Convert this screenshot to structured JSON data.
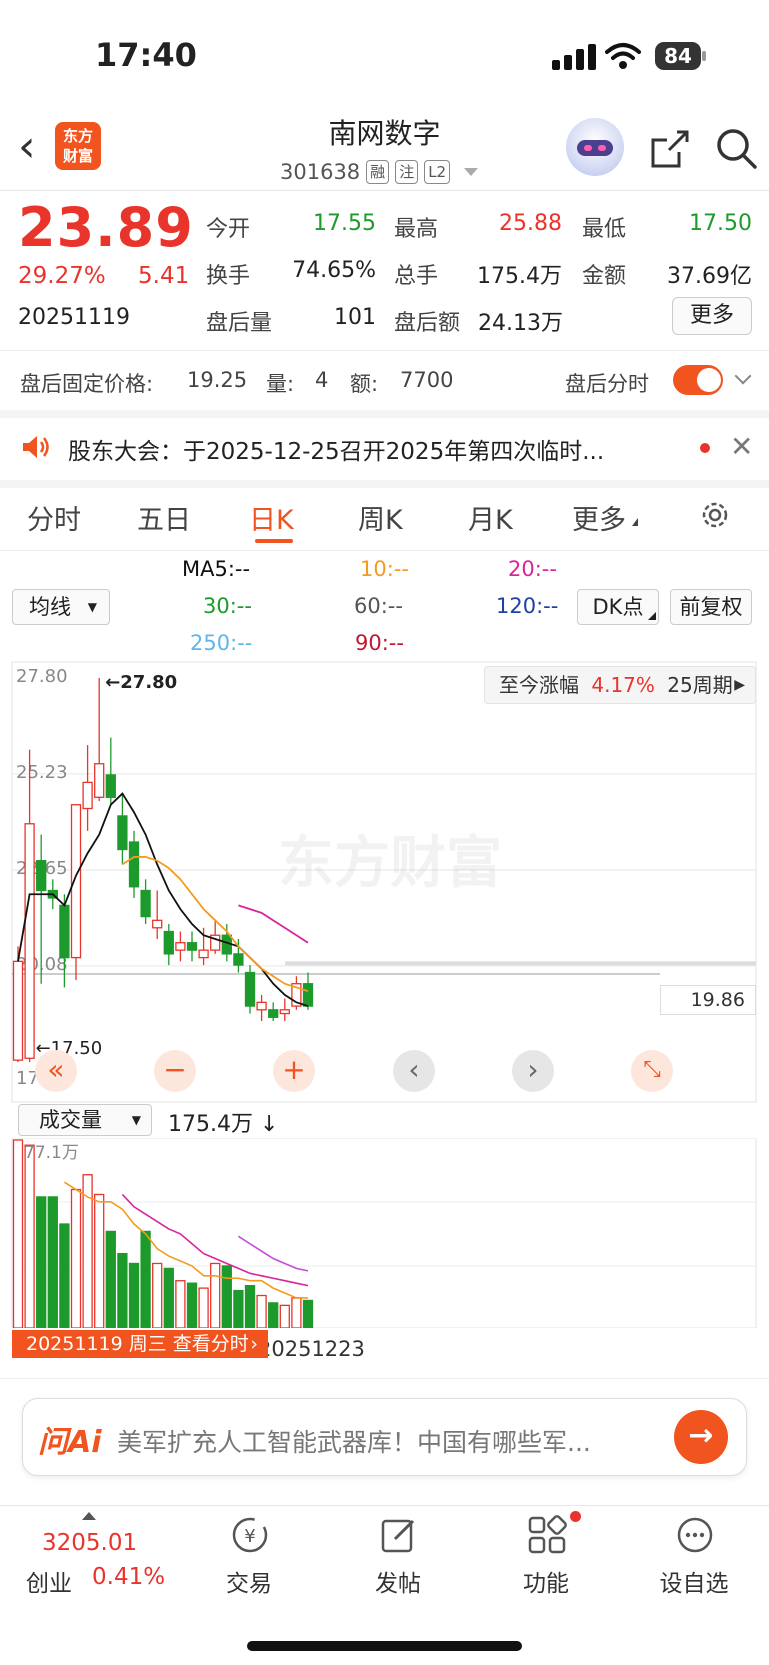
{
  "status_bar": {
    "time": "17:40",
    "battery": "84"
  },
  "header": {
    "logo_line1": "东方",
    "logo_line2": "财富",
    "stock_name": "南网数字",
    "stock_code": "301638",
    "tags": [
      "融",
      "注",
      "L2"
    ]
  },
  "quote": {
    "price": "23.89",
    "change_pct": "29.27%",
    "change_amt": "5.41",
    "date": "20251119",
    "rows": [
      [
        {
          "label": "今开",
          "value": "17.55",
          "color": "green"
        },
        {
          "label": "最高",
          "value": "25.88",
          "color": "red"
        },
        {
          "label": "最低",
          "value": "17.50",
          "color": "green"
        }
      ],
      [
        {
          "label": "换手",
          "value": "74.65%",
          "color": "plain"
        },
        {
          "label": "总手",
          "value": "175.4万",
          "color": "plain"
        },
        {
          "label": "金额",
          "value": "37.69亿",
          "color": "plain"
        }
      ],
      [
        {
          "label": "盘后量",
          "value": "101",
          "color": "plain"
        },
        {
          "label": "盘后额",
          "value": "24.13万",
          "color": "plain"
        }
      ]
    ],
    "more_label": "更多"
  },
  "after_hours": {
    "price_label": "盘后固定价格:",
    "price": "19.25",
    "vol_label": "量:",
    "vol": "4",
    "amt_label": "额:",
    "amt": "7700",
    "timeshare_label": "盘后分时"
  },
  "notice": {
    "text": "股东大会：于2025-12-25召开2025年第四次临时..."
  },
  "tabs": {
    "items": [
      "分时",
      "五日",
      "日K",
      "周K",
      "月K",
      "更多"
    ],
    "active": "日K"
  },
  "ma": {
    "selector": "均线",
    "ma5": "MA5:--",
    "ma10": "10:--",
    "ma20": "20:--",
    "ma30": "30:--",
    "ma60": "60:--",
    "ma120": "120:--",
    "ma250": "250:--",
    "ma90": "90:--",
    "dk_label": "DK点",
    "adjust_label": "前复权"
  },
  "colors": {
    "accent": "#f1541e",
    "up": "#e8342b",
    "down": "#1d9a2c",
    "ma5": "#111111",
    "ma10": "#f39b1f",
    "ma20": "#d9259b"
  },
  "chart_data": {
    "type": "candlestick",
    "y_ticks": [
      "27.80",
      "25.23",
      "22.65",
      "20.08",
      "17.50"
    ],
    "ylim": [
      17.5,
      27.8
    ],
    "high_marker": "27.80",
    "low_marker": "17.50",
    "last_price": "19.86",
    "range_label": "至今涨幅",
    "range_pct": "4.17%",
    "range_period": "25周期",
    "watermark": "东方财富",
    "candles": [
      {
        "o": 17.55,
        "c": 20.2,
        "h": 20.6,
        "l": 17.5
      },
      {
        "o": 17.6,
        "c": 23.89,
        "h": 25.88,
        "l": 17.5
      },
      {
        "o": 22.9,
        "c": 22.1,
        "h": 23.6,
        "l": 19.6
      },
      {
        "o": 22.1,
        "c": 21.9,
        "h": 22.4,
        "l": 21.6
      },
      {
        "o": 21.7,
        "c": 20.3,
        "h": 22.0,
        "l": 19.5
      },
      {
        "o": 20.3,
        "c": 24.4,
        "h": 24.4,
        "l": 19.7
      },
      {
        "o": 24.3,
        "c": 25.0,
        "h": 26.0,
        "l": 23.7
      },
      {
        "o": 24.6,
        "c": 25.5,
        "h": 27.8,
        "l": 24.5
      },
      {
        "o": 25.2,
        "c": 24.6,
        "h": 26.2,
        "l": 24.4
      },
      {
        "o": 24.1,
        "c": 23.2,
        "h": 24.7,
        "l": 22.8
      },
      {
        "o": 23.4,
        "c": 22.2,
        "h": 23.7,
        "l": 21.9
      },
      {
        "o": 22.1,
        "c": 21.4,
        "h": 22.4,
        "l": 21.2
      },
      {
        "o": 21.1,
        "c": 21.3,
        "h": 22.1,
        "l": 20.8
      },
      {
        "o": 21.0,
        "c": 20.4,
        "h": 21.2,
        "l": 20.1
      },
      {
        "o": 20.5,
        "c": 20.7,
        "h": 21.0,
        "l": 20.2
      },
      {
        "o": 20.7,
        "c": 20.5,
        "h": 21.0,
        "l": 20.2
      },
      {
        "o": 20.3,
        "c": 20.5,
        "h": 21.1,
        "l": 20.1
      },
      {
        "o": 20.5,
        "c": 20.9,
        "h": 21.3,
        "l": 20.4
      },
      {
        "o": 20.9,
        "c": 20.4,
        "h": 21.2,
        "l": 20.2
      },
      {
        "o": 20.4,
        "c": 20.1,
        "h": 20.8,
        "l": 19.9
      },
      {
        "o": 19.9,
        "c": 19.0,
        "h": 20.1,
        "l": 18.8
      },
      {
        "o": 18.9,
        "c": 19.1,
        "h": 19.3,
        "l": 18.6
      },
      {
        "o": 18.9,
        "c": 18.7,
        "h": 19.1,
        "l": 18.6
      },
      {
        "o": 18.8,
        "c": 18.9,
        "h": 19.2,
        "l": 18.6
      },
      {
        "o": 19.0,
        "c": 19.6,
        "h": 19.8,
        "l": 18.9
      },
      {
        "o": 19.6,
        "c": 19.0,
        "h": 19.9,
        "l": 18.9
      }
    ],
    "ma5": [
      20.2,
      22.0,
      22.0,
      22.0,
      21.7,
      22.5,
      23.1,
      23.6,
      24.4,
      24.7,
      24.2,
      23.6,
      22.8,
      22.1,
      21.6,
      21.2,
      20.9,
      20.8,
      20.7,
      20.6,
      20.3,
      20.0,
      19.6,
      19.3,
      19.1,
      19.0
    ],
    "ma10": [
      null,
      null,
      null,
      null,
      null,
      null,
      null,
      null,
      null,
      22.8,
      23.0,
      23.0,
      22.9,
      22.7,
      22.4,
      22.0,
      21.6,
      21.3,
      21.0,
      20.6,
      20.3,
      20.0,
      19.8,
      19.6,
      19.5,
      19.4
    ],
    "ma20": [
      null,
      null,
      null,
      null,
      null,
      null,
      null,
      null,
      null,
      null,
      null,
      null,
      null,
      null,
      null,
      null,
      null,
      null,
      null,
      21.7,
      21.6,
      21.5,
      21.3,
      21.1,
      20.9,
      20.7
    ],
    "volume": {
      "selector": "成交量",
      "current": "175.4万",
      "max_label": "77.1万",
      "ymax": 77.1,
      "values": [
        77.1,
        75.0,
        54.0,
        54.0,
        43.0,
        57.0,
        63.0,
        55.0,
        40.0,
        31.0,
        27.0,
        40.0,
        27.0,
        25.0,
        20.0,
        19.0,
        17.0,
        27.0,
        26.0,
        16.0,
        18.0,
        14.0,
        11.0,
        10.0,
        13.0,
        12.0
      ],
      "ma5": [
        null,
        null,
        null,
        null,
        60.0,
        57.0,
        54.0,
        52.0,
        52.0,
        49.0,
        43.0,
        39.0,
        33.0,
        30.0,
        28.0,
        26.0,
        22.0,
        22.0,
        21.0,
        21.0,
        20.0,
        20.0,
        17.0,
        15.0,
        13.0,
        13.0
      ],
      "ma10": [
        null,
        null,
        null,
        null,
        null,
        null,
        null,
        null,
        null,
        55.0,
        50.0,
        47.0,
        44.0,
        41.0,
        39.0,
        35.0,
        31.0,
        29.0,
        27.0,
        25.0,
        23.0,
        22.0,
        21.0,
        20.0,
        19.0,
        18.0
      ],
      "ma20": [
        null,
        null,
        null,
        null,
        null,
        null,
        null,
        null,
        null,
        null,
        null,
        null,
        null,
        null,
        null,
        null,
        null,
        null,
        null,
        38.0,
        35.0,
        32.0,
        29.0,
        27.0,
        25.0,
        24.0
      ],
      "date_start": "20251119",
      "date_end": "20251223",
      "tip": "20251119 周三 查看分时"
    }
  },
  "ai_bar": {
    "logo": "问Ai",
    "text": "美军扩充人工智能武器库！中国有哪些军..."
  },
  "bottom_nav": {
    "index_value": "3205.01",
    "index_name": "创业",
    "index_pct": "0.41%",
    "items": [
      "交易",
      "发帖",
      "功能",
      "设自选"
    ]
  }
}
